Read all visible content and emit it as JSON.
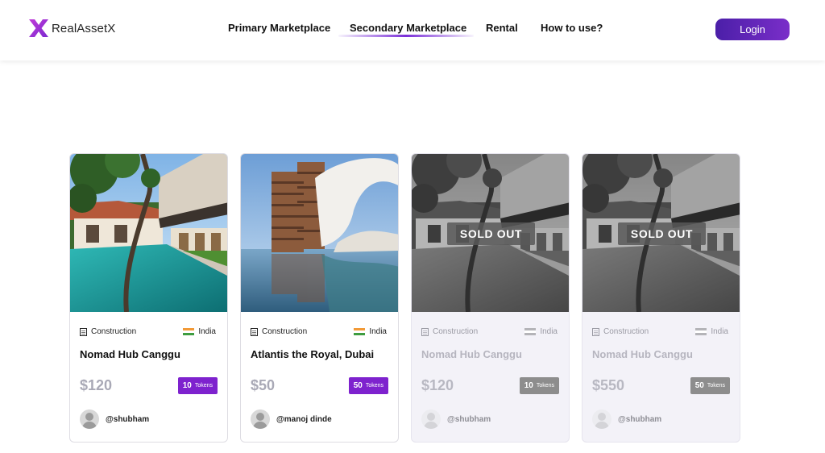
{
  "brand": {
    "name": "RealAssetX",
    "accent": "#7e22ce"
  },
  "nav": {
    "items": [
      {
        "label": "Primary Marketplace"
      },
      {
        "label": "Secondary Marketplace",
        "active": true
      },
      {
        "label": "Rental"
      },
      {
        "label": "How to use?"
      }
    ]
  },
  "header": {
    "login_label": "Login"
  },
  "properties": [
    {
      "type": "Construction",
      "country": "India",
      "title": "Nomad Hub Canggu",
      "price": "$120",
      "tokens": "10",
      "tokens_label": "Tokens",
      "owner": "@shubham",
      "status": "",
      "image": "villa-pool-photo"
    },
    {
      "type": "Construction",
      "country": "India",
      "title": "Atlantis the Royal, Dubai",
      "price": "$50",
      "tokens": "50",
      "tokens_label": "Tokens",
      "owner": "@manoj dinde",
      "status": "",
      "image": "tower-hotel-photo"
    },
    {
      "type": "Construction",
      "country": "India",
      "title": "Nomad Hub Canggu",
      "price": "$120",
      "tokens": "10",
      "tokens_label": "Tokens",
      "owner": "@shubham",
      "status": "SOLD OUT",
      "image": "villa-pool-photo"
    },
    {
      "type": "Construction",
      "country": "India",
      "title": "Nomad Hub Canggu",
      "price": "$550",
      "tokens": "50",
      "tokens_label": "Tokens",
      "owner": "@shubham",
      "status": "SOLD OUT",
      "image": "villa-pool-photo"
    }
  ]
}
